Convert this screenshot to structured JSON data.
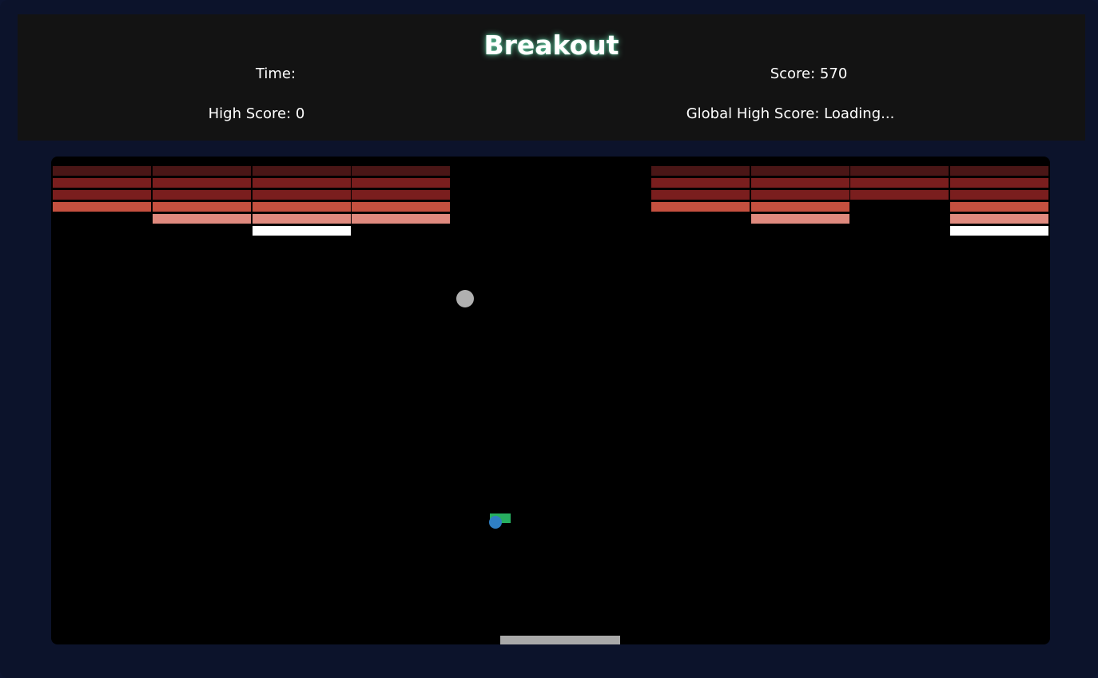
{
  "title": "Breakout",
  "stats": {
    "time_label": "Time:",
    "score_label": "Score: 570",
    "high_score_label": "High Score: 0",
    "global_high_score_label": "Global High Score: Loading..."
  },
  "colors": {
    "background": "#0c132b",
    "header_bg": "#131313",
    "canvas_bg": "#000000",
    "brick_row_1": "#4a1616",
    "brick_row_2": "#7a1e1e",
    "brick_row_3": "#7a1e1e",
    "brick_row_4": "#c4503f",
    "brick_row_5": "#e08a7e",
    "brick_row_6": "#ffffff",
    "ball": "#b0b0b0",
    "paddle": "#a9a9a9",
    "powerup_green": "#27ae60",
    "powerup_blue": "#2f7fc4"
  },
  "bricks": {
    "rows": 6,
    "columns": 10,
    "present": [
      [
        1,
        1,
        1,
        1,
        0,
        0,
        1,
        1,
        1,
        1
      ],
      [
        1,
        1,
        1,
        1,
        0,
        0,
        1,
        1,
        1,
        1
      ],
      [
        1,
        1,
        1,
        1,
        0,
        0,
        1,
        1,
        1,
        1
      ],
      [
        1,
        1,
        1,
        1,
        0,
        0,
        1,
        1,
        0,
        1
      ],
      [
        0,
        1,
        1,
        1,
        0,
        0,
        0,
        1,
        0,
        1
      ],
      [
        0,
        0,
        1,
        0,
        0,
        0,
        0,
        0,
        0,
        1
      ]
    ]
  }
}
